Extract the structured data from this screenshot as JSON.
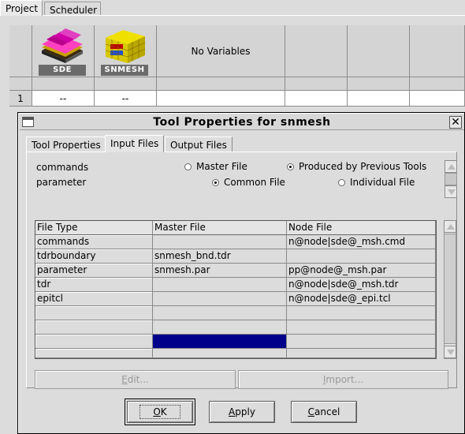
{
  "project_window": {
    "tabs": [
      "Project",
      "Scheduler"
    ],
    "tools": [
      {
        "label": "SDE",
        "icon": "sde-tool-icon"
      },
      {
        "label": "SNMESH",
        "icon": "snmesh-tool-icon"
      }
    ],
    "variables_header": "No Variables",
    "row_number": "1",
    "row_values": [
      "--",
      "--"
    ]
  },
  "dialog": {
    "title": "Tool Properties for snmesh",
    "tabs": [
      "Tool Properties",
      "Input Files",
      "Output Files"
    ],
    "active_tab": "Input Files",
    "options": {
      "commands_label": "commands",
      "parameter_label": "parameter",
      "master_file": "Master File",
      "produced_by_previous": "Produced by Previous Tools",
      "common_file": "Common File",
      "individual_file": "Individual File",
      "selected_commands": "Produced by Previous Tools",
      "selected_parameter": "Common File"
    },
    "table": {
      "columns": [
        "File Type",
        "Master File",
        "Node File"
      ],
      "rows": [
        [
          "commands",
          "",
          "n@node|sde@_msh.cmd"
        ],
        [
          "tdrboundary",
          "snmesh_bnd.tdr",
          ""
        ],
        [
          "parameter",
          "snmesh.par",
          "pp@node@_msh.par"
        ],
        [
          "tdr",
          "",
          "n@node|sde@_msh.tdr"
        ],
        [
          "epitcl",
          "",
          "n@node|sde@_epi.tcl"
        ],
        [
          "",
          "",
          ""
        ],
        [
          "",
          "",
          ""
        ],
        [
          "",
          "",
          ""
        ],
        [
          "",
          "",
          ""
        ]
      ],
      "selection_color": "#00008b"
    },
    "panel_buttons": {
      "edit": {
        "text": "Edit...",
        "key": "E"
      },
      "import": {
        "text": "Import...",
        "key": "I"
      }
    },
    "buttons": {
      "ok": {
        "text": "OK",
        "key": "O"
      },
      "apply": {
        "text": "Apply",
        "key": "A"
      },
      "cancel": {
        "text": "Cancel",
        "key": "C"
      }
    }
  }
}
